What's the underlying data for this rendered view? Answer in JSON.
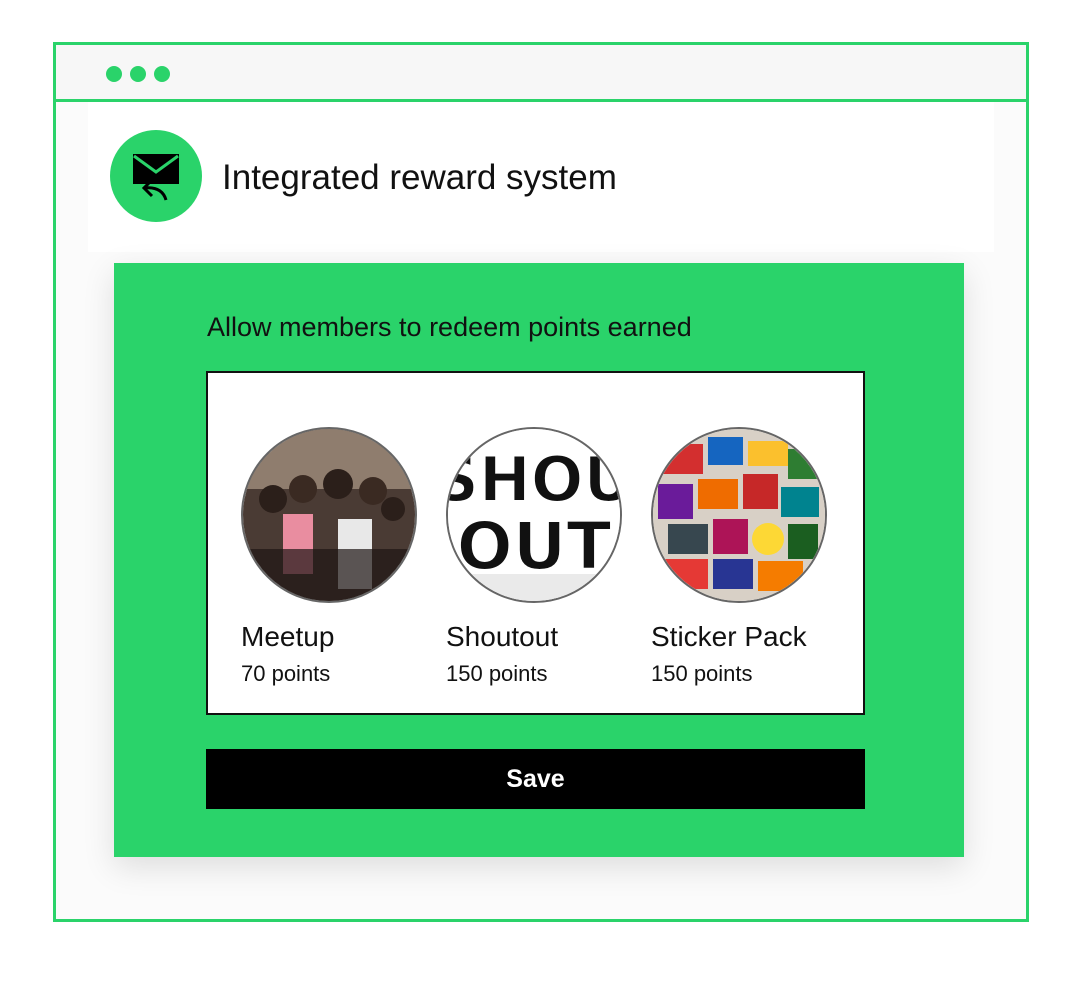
{
  "window": {
    "controls": [
      "dot",
      "dot",
      "dot"
    ]
  },
  "header": {
    "icon": "mail-reply-icon",
    "title": "Integrated reward system"
  },
  "panel": {
    "heading": "Allow members to redeem points earned",
    "rewards": [
      {
        "name": "Meetup",
        "points": "70 points",
        "image": "group-photo"
      },
      {
        "name": "Shoutout",
        "points": "150 points",
        "image": "shoutout-lettering"
      },
      {
        "name": "Sticker Pack",
        "points": "150 points",
        "image": "sticker-collage"
      }
    ],
    "save_label": "Save"
  },
  "colors": {
    "accent": "#2ad36a",
    "button": "#000000",
    "button_text": "#ffffff"
  }
}
